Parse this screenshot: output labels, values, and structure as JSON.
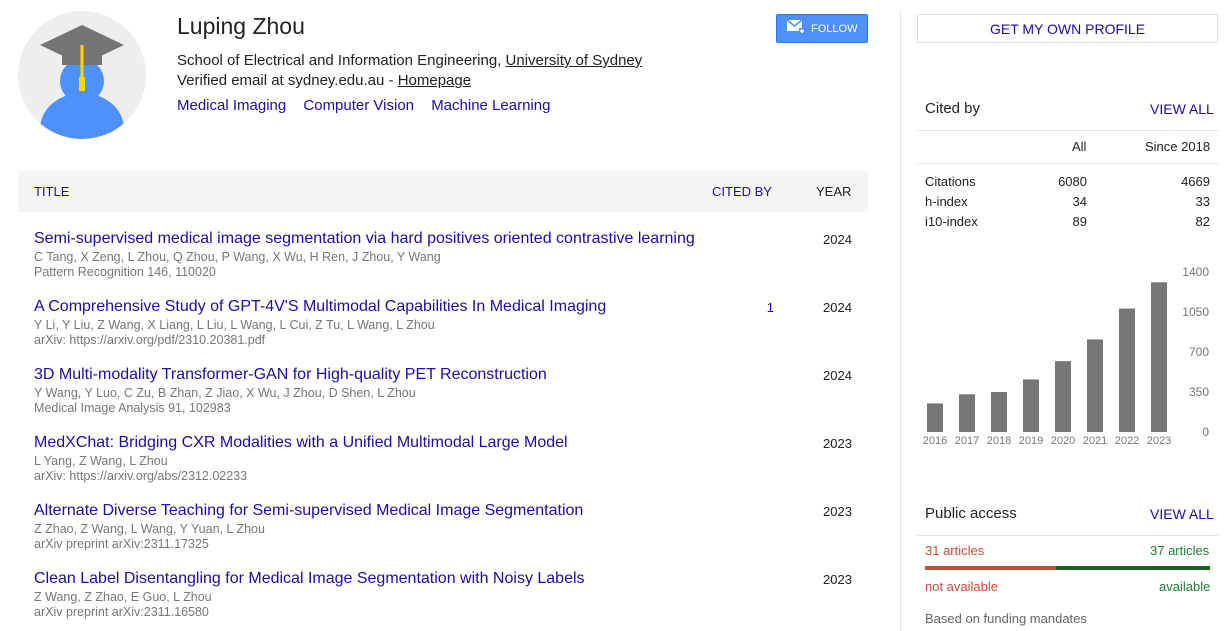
{
  "profile": {
    "name": "Luping Zhou",
    "affiliation_prefix": "School of Electrical and Information Engineering, ",
    "affiliation_link": "University of Sydney",
    "email_prefix": "Verified email at sydney.edu.au - ",
    "homepage": "Homepage",
    "interests": [
      "Medical Imaging",
      "Computer Vision",
      "Machine Learning"
    ],
    "follow_label": "FOLLOW",
    "avatar_icon": "graduation-cap-avatar-icon"
  },
  "table": {
    "headers": {
      "title": "TITLE",
      "cited_by": "CITED BY",
      "year": "YEAR"
    },
    "rows": [
      {
        "title": "Semi-supervised medical image segmentation via hard positives oriented contrastive learning",
        "authors": "C Tang, X Zeng, L Zhou, Q Zhou, P Wang, X Wu, H Ren, J Zhou, Y Wang",
        "venue": "Pattern Recognition 146, 110020",
        "cited": "",
        "year": "2024"
      },
      {
        "title": "A Comprehensive Study of GPT-4V'S Multimodal Capabilities In Medical Imaging",
        "authors": "Y Li, Y Liu, Z Wang, X Liang, L Liu, L Wang, L Cui, Z Tu, L Wang, L Zhou",
        "venue": "arXiv: https://arxiv.org/pdf/2310.20381.pdf",
        "cited": "1",
        "year": "2024"
      },
      {
        "title": "3D Multi-modality Transformer-GAN for High-quality PET Reconstruction",
        "authors": "Y Wang, Y Luo, C Zu, B Zhan, Z Jiao, X Wu, J Zhou, D Shen, L Zhou",
        "venue": "Medical Image Analysis 91, 102983",
        "cited": "",
        "year": "2024"
      },
      {
        "title": "MedXChat: Bridging CXR Modalities with a Unified Multimodal Large Model",
        "authors": "L Yang, Z Wang, L Zhou",
        "venue": "arXiv: https://arxiv.org/abs/2312.02233",
        "cited": "",
        "year": "2023"
      },
      {
        "title": "Alternate Diverse Teaching for Semi-supervised Medical Image Segmentation",
        "authors": "Z Zhao, Z Wang, L Wang, Y Yuan, L Zhou",
        "venue": "arXiv preprint arXiv:2311.17325",
        "cited": "",
        "year": "2023"
      },
      {
        "title": "Clean Label Disentangling for Medical Image Segmentation with Noisy Labels",
        "authors": "Z Wang, Z Zhao, E Guo, L Zhou",
        "venue": "arXiv preprint arXiv:2311.16580",
        "cited": "",
        "year": "2023"
      }
    ]
  },
  "sidebar": {
    "own_profile_label": "GET MY OWN PROFILE",
    "cited_by_title": "Cited by",
    "view_all": "VIEW ALL",
    "col_all": "All",
    "col_since": "Since 2018",
    "stats": [
      {
        "label": "Citations",
        "all": "6080",
        "since": "4669"
      },
      {
        "label": "h-index",
        "all": "34",
        "since": "33"
      },
      {
        "label": "i10-index",
        "all": "89",
        "since": "82"
      }
    ],
    "public_access_title": "Public access",
    "pa_view_all": "VIEW ALL",
    "pa_not_count": "31 articles",
    "pa_avail_count": "37 articles",
    "pa_not_label": "not available",
    "pa_avail_label": "available",
    "pa_note": "Based on funding mandates",
    "colors": {
      "bar": "#777777",
      "link": "#1a0dab",
      "not_available": "#c0503c",
      "available": "#1b5e20"
    }
  },
  "chart_data": {
    "type": "bar",
    "categories": [
      "2016",
      "2017",
      "2018",
      "2019",
      "2020",
      "2021",
      "2022",
      "2023"
    ],
    "values": [
      250,
      330,
      350,
      460,
      620,
      810,
      1080,
      1310
    ],
    "ylim": [
      0,
      1400
    ],
    "yticks": [
      0,
      350,
      700,
      1050,
      1400
    ],
    "title": "",
    "xlabel": "",
    "ylabel": ""
  }
}
